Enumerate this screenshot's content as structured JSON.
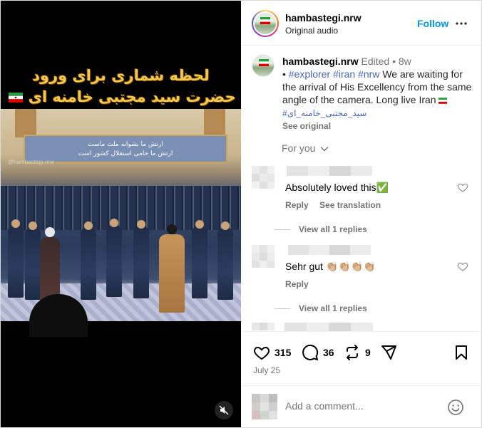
{
  "media": {
    "overlay_line1": "لحظه شماری برای ورود",
    "overlay_line2": "حضرت سید مجتبی خامنه ای",
    "banner_line1": "ارتش ما بشوانه ملت ماست",
    "banner_line2": "ارتش ما حامی استقلال کشور است",
    "watermark": "@hambastegi.nrw"
  },
  "header": {
    "username": "hambastegi.nrw",
    "subtitle": "Original audio",
    "follow_label": "Follow"
  },
  "caption": {
    "username": "hambastegi.nrw",
    "edited": "Edited",
    "dot": "•",
    "age": "8w",
    "bullet": "•",
    "hashtags": "#explorer #iran #nrw",
    "text": "We are waiting for the arrival of His Excellency from the same angle of the camera. Long live Iran",
    "persian_tag": "#سید_مجتبی_خامنه_ای",
    "see_original": "See original"
  },
  "for_you": "For you",
  "comments": [
    {
      "text": "Absolutely loved this✅",
      "reply": "Reply",
      "translate": "See translation",
      "view_replies": "View all 1 replies"
    },
    {
      "text": "Sehr gut 👏🏼👏🏼👏🏼👏🏼",
      "reply": "Reply",
      "view_replies": "View all 1 replies"
    }
  ],
  "actions": {
    "likes": "315",
    "comments": "36",
    "reposts": "9",
    "date": "July 25"
  },
  "comment_input": {
    "placeholder": "Add a comment..."
  },
  "icons": {
    "like": "heart-icon",
    "comment": "comment-icon",
    "repost": "repost-icon",
    "share": "send-icon",
    "save": "bookmark-icon",
    "emoji": "emoji-icon",
    "mute": "muted-speaker-icon",
    "more": "more-options-icon"
  },
  "colors": {
    "link": "#0095f6",
    "hashtag": "#00376b",
    "muted": "#737373"
  }
}
